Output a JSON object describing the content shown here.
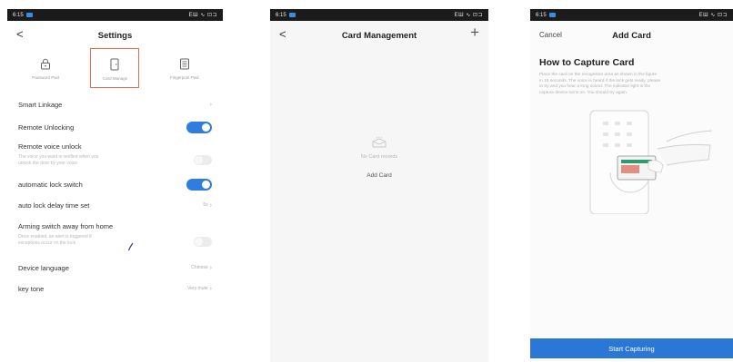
{
  "status": {
    "time": "6:15",
    "right": "ЕШ ∿ ⊡⊐"
  },
  "screen1": {
    "title": "Settings",
    "back_glyph": "<",
    "functions": [
      {
        "label": "Password Pwd",
        "icon": "lock-icon"
      },
      {
        "label": "Card Manage",
        "icon": "card-door-icon",
        "selected": true
      },
      {
        "label": "Fingerprint Pwd",
        "icon": "list-icon"
      }
    ],
    "rows": {
      "smart_linkage": {
        "label": "Smart Linkage"
      },
      "remote_unlocking": {
        "label": "Remote Unlocking",
        "on": true
      },
      "remote_voice": {
        "label": "Remote voice unlock",
        "sub1": "The voice you want is verified when you",
        "sub2": "unlock the door by your voice",
        "on": false
      },
      "auto_lock": {
        "label": "automatic lock switch",
        "on": true
      },
      "auto_lock_delay": {
        "label": "auto lock delay time set",
        "value": "5s"
      },
      "arming": {
        "label": "Arming switch away from home",
        "sub1": "Once enabled, an alert is triggered if",
        "sub2": "exceptions occur on the lock",
        "on": false
      },
      "device_language": {
        "label": "Device language",
        "value": "Chinese"
      },
      "key_tone": {
        "label": "key tone",
        "value": "Very mute"
      }
    }
  },
  "screen2": {
    "title": "Card Management",
    "back_glyph": "<",
    "plus_glyph": "+",
    "empty_text": "No Card records",
    "add_label": "Add Card"
  },
  "screen3": {
    "cancel_label": "Cancel",
    "title": "Add Card",
    "heading": "How to Capture Card",
    "desc1": "Place the card on the recognition area as shown in the figure",
    "desc2": "in 15 seconds. The voice is heard if the lock gets ready, please",
    "desc3": "to try and you hear a long sound. The indicator light is the",
    "desc4": "capture device turns on. You should try again.",
    "cta_label": "Start Capturing"
  },
  "colors": {
    "accent": "#2f7de1",
    "button": "#2a77d6",
    "selected_border": "#e86b4a"
  }
}
